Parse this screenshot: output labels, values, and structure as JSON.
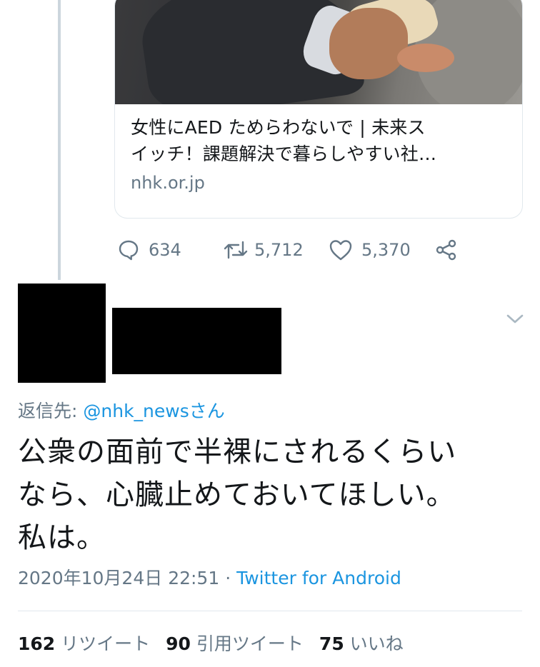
{
  "link_card": {
    "title_line1": "女性にAED ためらわないで | 未来ス",
    "title_line2": "イッチ！課題解決で暮らしやすい社…",
    "domain": "nhk.or.jp"
  },
  "parent_actions": {
    "reply_count": "634",
    "retweet_count": "5,712",
    "like_count": "5,370"
  },
  "reply": {
    "reply_to_label": "返信先: ",
    "reply_to_mention": "@nhk_newsさん",
    "text_lines": [
      "公衆の面前で半裸にされるくらい",
      "なら、心臓止めておいてほしい。",
      "私は。"
    ],
    "timestamp": "2020年10月24日 22:51",
    "separator": " · ",
    "source": "Twitter for Android",
    "stats": {
      "retweets_num": "162",
      "retweets_label": "リツイート",
      "quotes_num": "90",
      "quotes_label": "引用ツイート",
      "likes_num": "75",
      "likes_label": "いいね"
    }
  },
  "colors": {
    "accent": "#1b95e0",
    "secondary_text": "#657786",
    "primary_text": "#14171a",
    "border": "#e1e8ed",
    "redaction": "#000000"
  }
}
